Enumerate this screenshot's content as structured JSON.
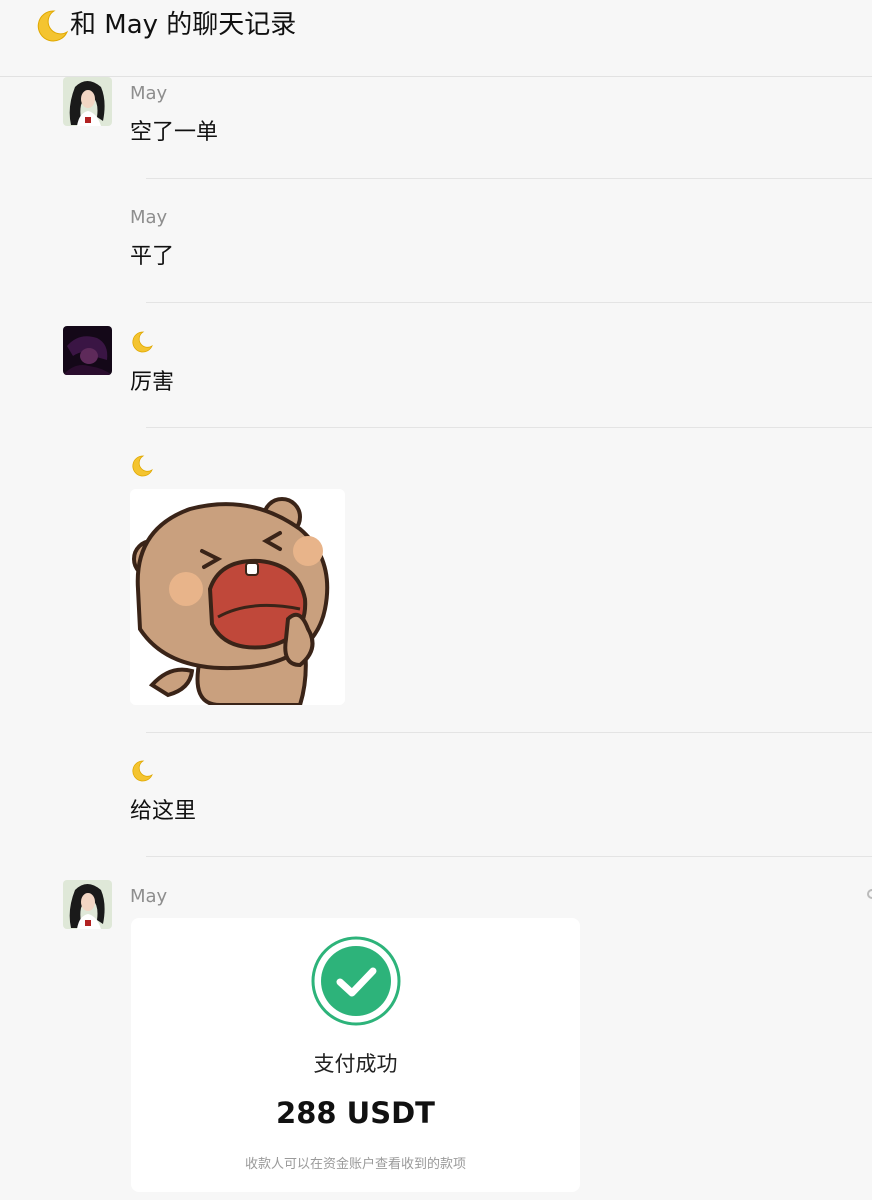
{
  "header": {
    "title": "和 May 的聊天记录",
    "moon_icon": "crescent-moon-icon"
  },
  "messages": [
    {
      "sender": "May",
      "avatar": "woman-avatar",
      "text": "空了一单"
    },
    {
      "sender": "May",
      "text": "平了"
    },
    {
      "sender": "🌙",
      "avatar": "dark-avatar",
      "text": "厉害"
    },
    {
      "sender": "🌙",
      "type": "sticker",
      "sticker": "crying-bear-sticker"
    },
    {
      "sender": "🌙",
      "text": "给这里"
    },
    {
      "sender": "May",
      "avatar": "woman-avatar",
      "type": "payment"
    }
  ],
  "payment": {
    "status": "支付成功",
    "amount": "288 USDT",
    "note": "收款人可以在资金账户查看收到的款项",
    "accent": "#2db37a"
  }
}
